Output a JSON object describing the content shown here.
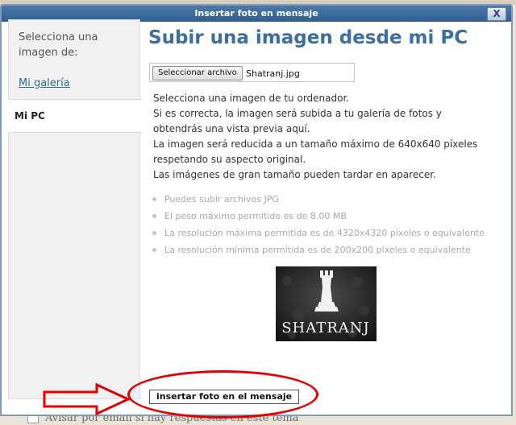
{
  "dialog": {
    "title": "Insertar foto en mensaje",
    "close_symbol": "X"
  },
  "sidebar": {
    "heading": "Selecciona una imagen de:",
    "gallery_link": "Mi galería",
    "active_tab": "Mi PC"
  },
  "main": {
    "heading": "Subir una imagen desde mi PC",
    "file_input": {
      "button_label": "Seleccionar archivo",
      "file_name": "Shatranj.jpg"
    },
    "description_lines": [
      "Selecciona una imagen de tu ordenador.",
      "Si es correcta, la imagen será subida a tu galería de fotos y",
      "obtendrás una vista previa aquí.",
      "La imagen será reducida a un tamaño máximo de 640x640 píxeles",
      "respetando su aspecto original.",
      "Las imágenes de gran tamaño pueden tardar en aparecer."
    ],
    "rules": [
      "Puedes subir archivos JPG",
      "El peso máximo permitido es de 8.00 MB",
      "La resolución máxima permitida es de 4320x4320 píxeles o equivalente",
      "La resolución mínima permitida es de 200x200 píxeles o equivalente"
    ],
    "preview": {
      "logo_text": "SHATRANJ"
    },
    "insert_button": "insertar foto en el mensaje"
  },
  "background": {
    "email_notify_text": "Avisar por email si hay respuestas en este tema"
  },
  "colors": {
    "title_bar": "#3a6898",
    "heading": "#3b6ea5",
    "link": "#2c6aa0",
    "annotation": "#e20000"
  }
}
